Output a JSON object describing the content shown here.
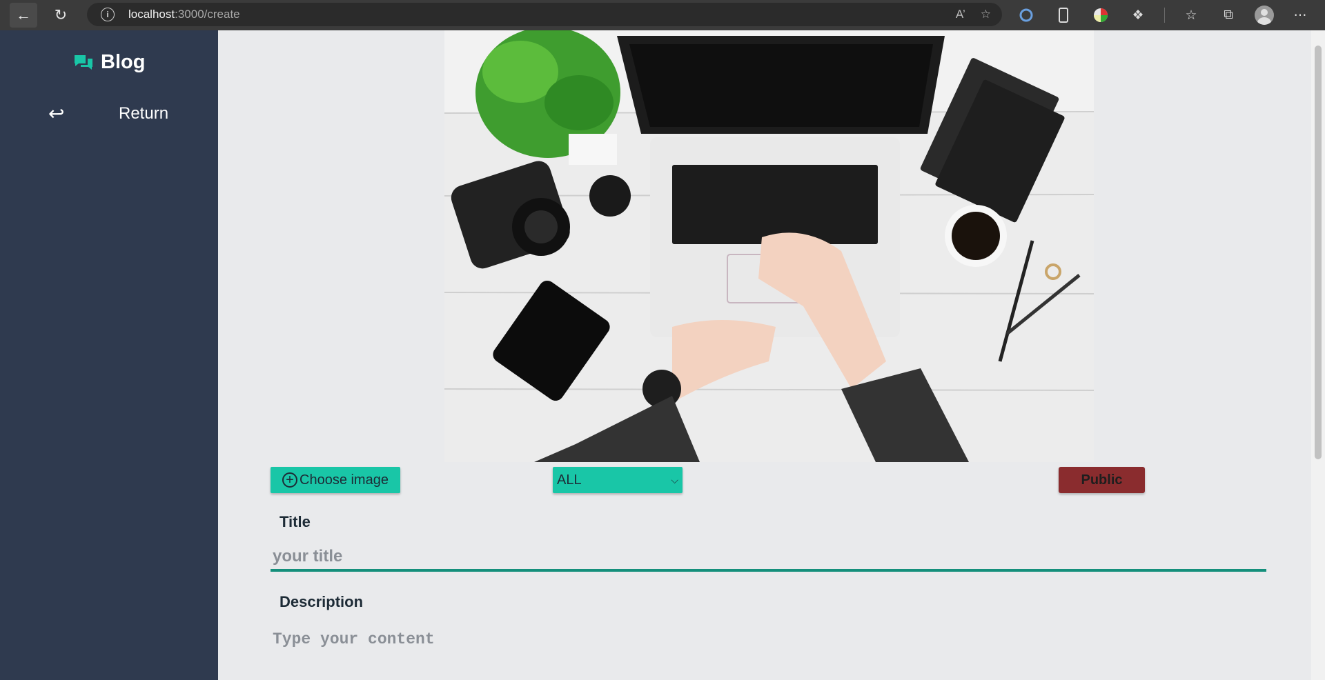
{
  "browser": {
    "url_host": "localhost",
    "url_path": ":3000/create"
  },
  "sidebar": {
    "brand": "Blog",
    "return_label": "Return",
    "accent_color": "#19c6a7",
    "background": "#2f3a4f"
  },
  "editor": {
    "choose_image_label": "Choose image",
    "category_selected": "ALL",
    "public_label": "Public",
    "title_label": "Title",
    "title_placeholder": "your title",
    "description_label": "Description",
    "description_placeholder": "Type your content"
  },
  "colors": {
    "button_teal": "#19c6a7",
    "public_red": "#8a2c2e",
    "underline": "#148f7b"
  },
  "icons": {
    "back": "back-arrow-icon",
    "reload": "reload-icon",
    "info": "info-icon",
    "brand": "chat-bubbles-icon",
    "return": "return-arrow-icon",
    "choose_image": "plus-circle-icon"
  }
}
